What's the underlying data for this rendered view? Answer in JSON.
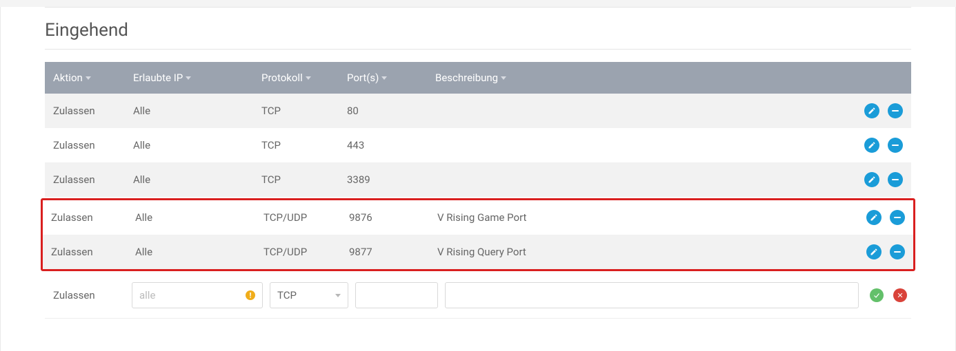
{
  "section_title": "Eingehend",
  "columns": {
    "aktion": "Aktion",
    "ip": "Erlaubte IP",
    "protokoll": "Protokoll",
    "ports": "Port(s)",
    "beschreibung": "Beschreibung"
  },
  "rows": [
    {
      "aktion": "Zulassen",
      "ip": "Alle",
      "protokoll": "TCP",
      "ports": "80",
      "beschreibung": ""
    },
    {
      "aktion": "Zulassen",
      "ip": "Alle",
      "protokoll": "TCP",
      "ports": "443",
      "beschreibung": ""
    },
    {
      "aktion": "Zulassen",
      "ip": "Alle",
      "protokoll": "TCP",
      "ports": "3389",
      "beschreibung": ""
    }
  ],
  "highlighted_rows": [
    {
      "aktion": "Zulassen",
      "ip": "Alle",
      "protokoll": "TCP/UDP",
      "ports": "9876",
      "beschreibung": "V Rising Game Port"
    },
    {
      "aktion": "Zulassen",
      "ip": "Alle",
      "protokoll": "TCP/UDP",
      "ports": "9877",
      "beschreibung": "V Rising Query Port"
    }
  ],
  "add_row": {
    "aktion_label": "Zulassen",
    "ip_placeholder": "alle",
    "protokoll_value": "TCP",
    "ports_value": "",
    "beschreibung_value": ""
  },
  "colors": {
    "header_bg": "#9ba3af",
    "accent": "#1a9cd8",
    "highlight_border": "#d91f1f",
    "ok": "#63c06a",
    "cancel": "#d9433a",
    "warn": "#f0ad1a"
  }
}
